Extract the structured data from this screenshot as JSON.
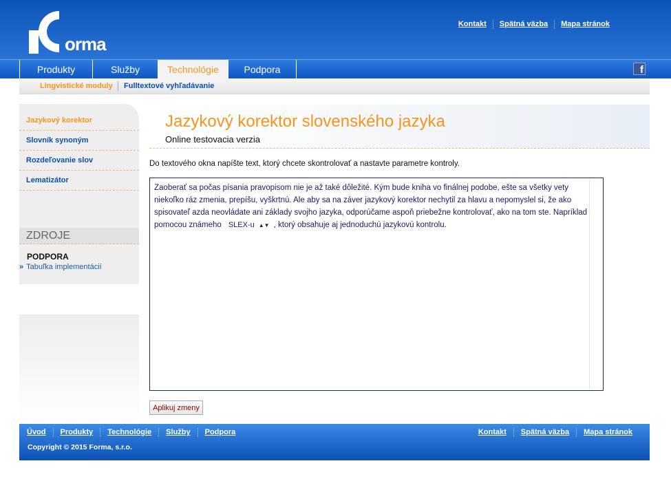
{
  "header": {
    "logo_text": "orma",
    "links": [
      "Kontakt",
      "Spätná väzba",
      "Mapa stránok"
    ]
  },
  "nav": {
    "tabs": [
      "Produkty",
      "Služby",
      "Technológie",
      "Podpora"
    ],
    "active_tab": "Technológie",
    "fb_icon": "f"
  },
  "subnav": {
    "items": [
      "Lingvistické moduly",
      "Fulltextové vyhľadávanie"
    ]
  },
  "sidebar": {
    "items": [
      "Jazykový korektor",
      "Slovník synoným",
      "Rozdeľovanie slov",
      "Lematizátor"
    ],
    "section_title": "ZDROJE",
    "support_title": "PODPORA",
    "support_link": "Tabuľka implementácií"
  },
  "main": {
    "title": "Jazykový korektor slovenského jazyka",
    "subtitle": "Online testovacia verzia",
    "instructions": "Do textového okna napíšte text, ktorý chcete skontrolovať a nastavte parametre kontroly.",
    "editor_text_before": "Zaoberať sa počas písania pravopisom nie je až také dôležité. Kým bude kniha vo finálnej podobe, ešte sa všetky vety niekoľko ráz zmenia, prepíšu, vyškrtnú. Ale aby sa na záver jazykový korektor nechytil za hlavu a nepomyslel si, že ako spisovateľ azda neovládate ani základy svojho jazyka, odporúčame aspoň priebežne kontrolovať, ako na tom ste. Napríklad pomocou známeho",
    "editor_select_value": "SLEX-u",
    "editor_text_after": ", ktorý obsahuje aj jednoduchú jazykovú kontrolu.",
    "apply_button": "Aplikuj zmeny"
  },
  "footer": {
    "left_links": [
      "Úvod",
      "Produkty",
      "Technológie",
      "Služby",
      "Podpora"
    ],
    "right_links": [
      "Kontakt",
      "Spätná väzba",
      "Mapa stránok"
    ],
    "copyright": "Copyright © 2015 Forma, s.r.o."
  },
  "colors": {
    "accent_orange": "#f7941d",
    "header_blue": "#0d54b8",
    "link_blue": "#0d4fa8"
  }
}
